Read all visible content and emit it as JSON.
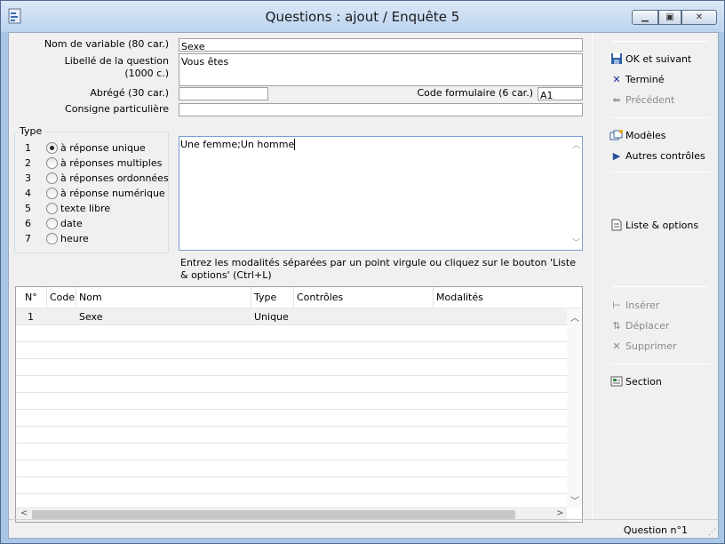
{
  "window": {
    "title": "Questions : ajout / Enquête 5",
    "minimize_icon": "minimize-icon",
    "maximize_icon": "maximize-icon",
    "close_icon": "close-icon"
  },
  "form": {
    "nom_label": "Nom de variable (80 car.)",
    "nom_value": "Sexe",
    "libelle_label_line1": "Libellé de la question",
    "libelle_label_line2": "(1000 c.)",
    "libelle_value": "Vous êtes",
    "abrege_label": "Abrégé (30 car.)",
    "abrege_value": "",
    "code_label": "Code formulaire  (6 car.)",
    "code_value": "A1",
    "consigne_label": "Consigne particulière",
    "consigne_value": ""
  },
  "type_group": {
    "title": "Type",
    "options": [
      {
        "num": "1",
        "label": "à réponse unique",
        "checked": true
      },
      {
        "num": "2",
        "label": "à réponses multiples",
        "checked": false
      },
      {
        "num": "3",
        "label": "à réponses ordonnées",
        "checked": false
      },
      {
        "num": "4",
        "label": "à réponse numérique",
        "checked": false
      },
      {
        "num": "5",
        "label": "texte libre",
        "checked": false
      },
      {
        "num": "6",
        "label": "date",
        "checked": false
      },
      {
        "num": "7",
        "label": "heure",
        "checked": false
      }
    ]
  },
  "modalites": {
    "value": "Une femme;Un homme",
    "hint": "Entrez les modalités séparées par un point virgule ou cliquez sur le bouton 'Liste & options' (Ctrl+L)"
  },
  "table": {
    "headers": [
      "N°",
      "Code",
      "Nom",
      "Type",
      "Contrôles",
      "Modalités"
    ],
    "rows": [
      {
        "num": "1",
        "code": "",
        "nom": "Sexe",
        "type": "Unique",
        "controles": "",
        "modalites": ""
      }
    ]
  },
  "sidebar": {
    "ok": "OK et suivant",
    "termine": "Terminé",
    "precedent": "Précédent",
    "modeles": "Modèles",
    "autres": "Autres contrôles",
    "liste": "Liste & options",
    "inserer": "Insérer",
    "deplacer": "Déplacer",
    "supprimer": "Supprimer",
    "section": "Section"
  },
  "status": {
    "text": "Question n°1"
  }
}
